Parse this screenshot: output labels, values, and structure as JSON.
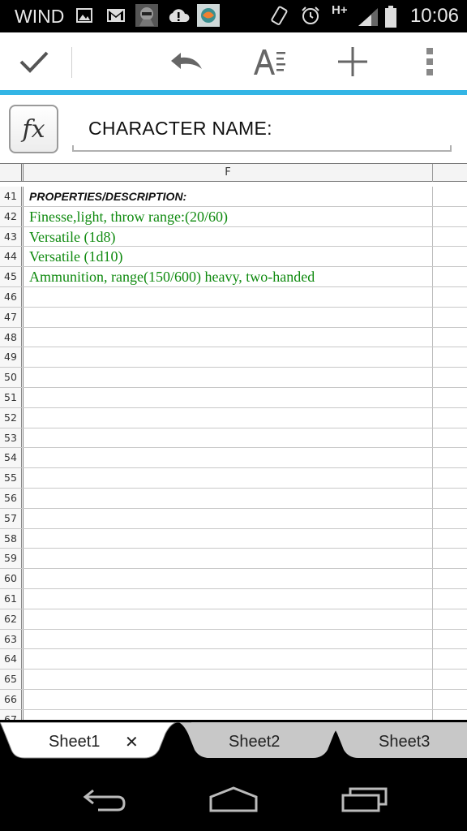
{
  "status_bar": {
    "carrier": "WIND",
    "time": "10:06",
    "network": "H+"
  },
  "toolbar": {
    "confirm_icon": "check-icon",
    "undo_icon": "undo-icon",
    "format_icon": "text-format-icon",
    "insert_icon": "plus-icon",
    "menu_icon": "overflow-menu-icon"
  },
  "formula_bar": {
    "fx_label": "fx",
    "value": "CHARACTER NAME:"
  },
  "grid": {
    "column_header": "F",
    "rows": [
      {
        "num": "41",
        "text": "PROPERTIES/DESCRIPTION:"
      },
      {
        "num": "42",
        "text": "Finesse,light, throw range:(20/60)"
      },
      {
        "num": "43",
        "text": "Versatile (1d8)"
      },
      {
        "num": "44",
        "text": "Versatile (1d10)"
      },
      {
        "num": "45",
        "text": "Ammunition, range(150/600) heavy, two-handed"
      },
      {
        "num": "46",
        "text": ""
      },
      {
        "num": "47",
        "text": ""
      },
      {
        "num": "48",
        "text": ""
      },
      {
        "num": "49",
        "text": ""
      },
      {
        "num": "50",
        "text": ""
      },
      {
        "num": "51",
        "text": ""
      },
      {
        "num": "52",
        "text": ""
      },
      {
        "num": "53",
        "text": ""
      },
      {
        "num": "54",
        "text": ""
      },
      {
        "num": "55",
        "text": ""
      },
      {
        "num": "56",
        "text": ""
      },
      {
        "num": "57",
        "text": ""
      },
      {
        "num": "58",
        "text": ""
      },
      {
        "num": "59",
        "text": ""
      },
      {
        "num": "60",
        "text": ""
      },
      {
        "num": "61",
        "text": ""
      },
      {
        "num": "62",
        "text": ""
      },
      {
        "num": "63",
        "text": ""
      },
      {
        "num": "64",
        "text": ""
      },
      {
        "num": "65",
        "text": ""
      },
      {
        "num": "66",
        "text": ""
      },
      {
        "num": "67",
        "text": ""
      }
    ],
    "text_color": "#0f8a0f"
  },
  "sheets": {
    "tabs": [
      "Sheet1",
      "Sheet2",
      "Sheet3"
    ],
    "active": "Sheet1",
    "close_symbol": "✕"
  },
  "colors": {
    "accent": "#33b5e5"
  }
}
